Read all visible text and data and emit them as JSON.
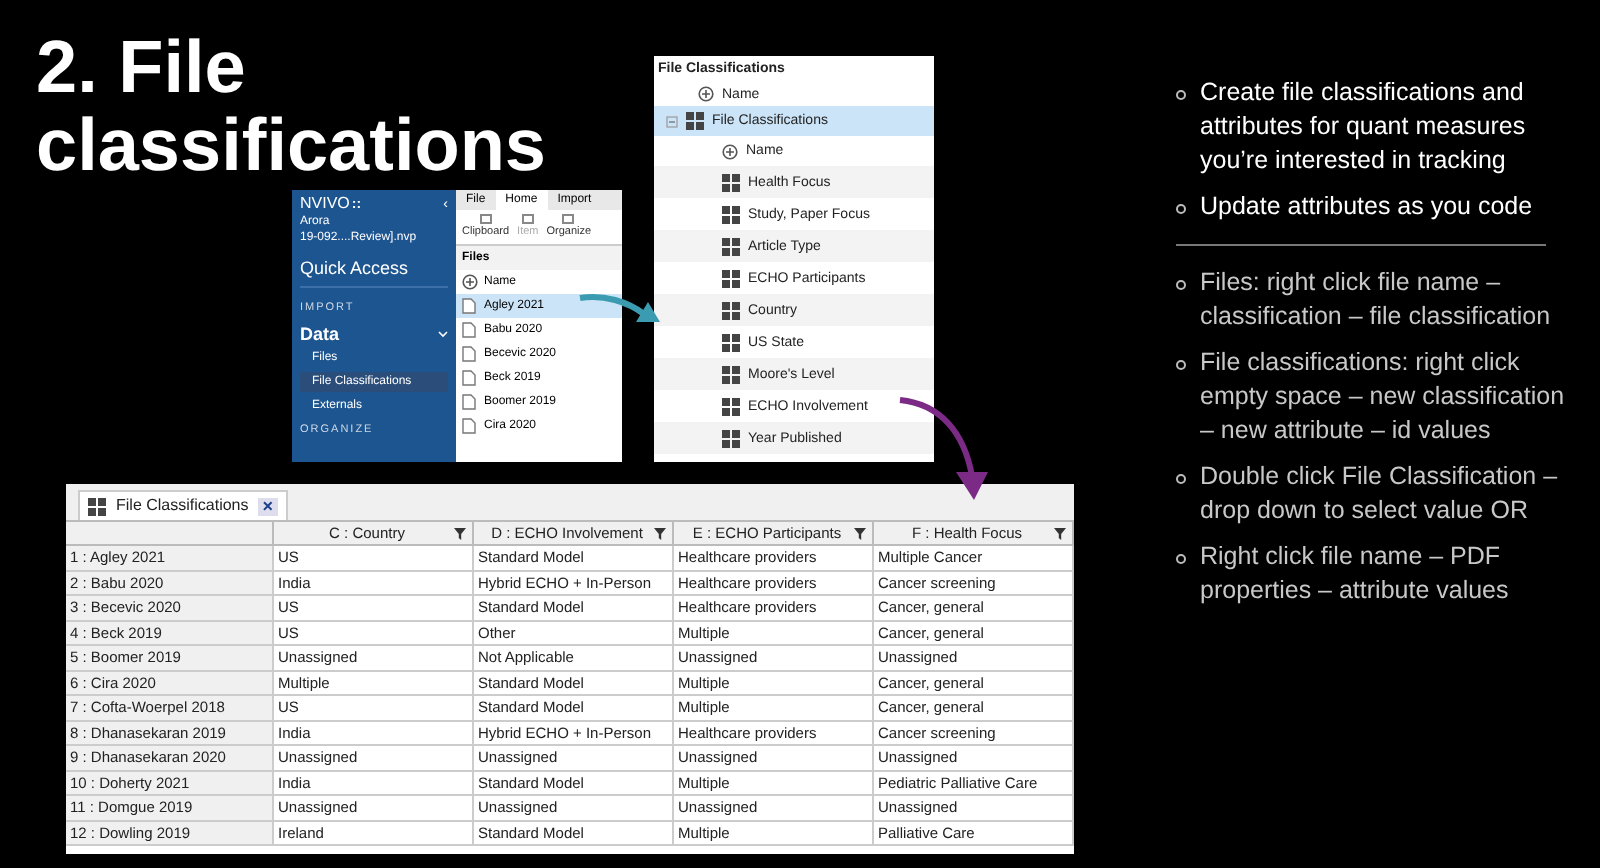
{
  "title": "2. File classifications",
  "nvivo": {
    "logo": "NVIVO",
    "logo_mark": "::",
    "collapse": "‹",
    "project": "Arora",
    "file": "19-092....Review].nvp",
    "nav": [
      {
        "kind": "link",
        "label": "Quick Access"
      },
      {
        "kind": "section",
        "label": "IMPORT"
      },
      {
        "kind": "group",
        "label": "Data",
        "expanded": true,
        "children": [
          {
            "label": "Files",
            "selected": false
          },
          {
            "label": "File Classifications",
            "selected": true
          },
          {
            "label": "Externals",
            "selected": false
          }
        ]
      },
      {
        "kind": "section",
        "label": "ORGANIZE"
      }
    ],
    "ribbon_tabs": [
      {
        "label": "File",
        "selected": false
      },
      {
        "label": "Home",
        "selected": true
      },
      {
        "label": "Import",
        "selected": false
      }
    ],
    "ribbon_buttons": [
      {
        "label": "Clipboard",
        "disabled": false
      },
      {
        "label": "Item",
        "disabled": true
      },
      {
        "label": "Organize",
        "disabled": false
      }
    ],
    "list_title": "Files",
    "list_header": "Name",
    "files": [
      {
        "name": "Agley 2021",
        "selected": true
      },
      {
        "name": "Babu 2020",
        "selected": false
      },
      {
        "name": "Becevic 2020",
        "selected": false
      },
      {
        "name": "Beck 2019",
        "selected": false
      },
      {
        "name": "Boomer 2019",
        "selected": false
      },
      {
        "name": "Cira 2020",
        "selected": false
      }
    ]
  },
  "classifications_panel": {
    "title": "File Classifications",
    "header": "Name",
    "tree": [
      {
        "label": "File Classifications",
        "selected": true,
        "expanded": true,
        "children": [
          {
            "kind": "header",
            "label": "Name"
          },
          {
            "kind": "attribute",
            "label": "Health Focus"
          },
          {
            "kind": "attribute",
            "label": "Study, Paper Focus"
          },
          {
            "kind": "attribute",
            "label": "Article Type"
          },
          {
            "kind": "attribute",
            "label": "ECHO Participants"
          },
          {
            "kind": "attribute",
            "label": "Country"
          },
          {
            "kind": "attribute",
            "label": "US State"
          },
          {
            "kind": "attribute",
            "label": "Moore's Level"
          },
          {
            "kind": "attribute",
            "label": "ECHO Involvement"
          },
          {
            "kind": "attribute",
            "label": "Year Published"
          }
        ]
      }
    ]
  },
  "table": {
    "tab": "File Classifications",
    "close": "×",
    "columns": [
      "",
      "C : Country",
      "D : ECHO Involvement",
      "E : ECHO Participants",
      "F : Health Focus"
    ],
    "rows": [
      [
        "1 : Agley 2021",
        "US",
        "Standard Model",
        "Healthcare providers",
        "Multiple Cancer"
      ],
      [
        "2 : Babu 2020",
        "India",
        "Hybrid ECHO + In-Person",
        "Healthcare providers",
        "Cancer screening"
      ],
      [
        "3 : Becevic 2020",
        "US",
        "Standard Model",
        "Healthcare providers",
        "Cancer, general"
      ],
      [
        "4 : Beck 2019",
        "US",
        "Other",
        "Multiple",
        "Cancer, general"
      ],
      [
        "5 : Boomer 2019",
        "Unassigned",
        "Not Applicable",
        "Unassigned",
        "Unassigned"
      ],
      [
        "6 : Cira 2020",
        "Multiple",
        "Standard Model",
        "Multiple",
        "Cancer, general"
      ],
      [
        "7 : Cofta-Woerpel 2018",
        "US",
        "Standard Model",
        "Multiple",
        "Cancer, general"
      ],
      [
        "8 : Dhanasekaran 2019",
        "India",
        "Hybrid ECHO + In-Person",
        "Healthcare providers",
        "Cancer screening"
      ],
      [
        "9 : Dhanasekaran 2020",
        "Unassigned",
        "Unassigned",
        "Unassigned",
        "Unassigned"
      ],
      [
        "10 : Doherty 2021",
        "India",
        "Standard Model",
        "Multiple",
        "Pediatric Palliative Care"
      ],
      [
        "11 : Domgue 2019",
        "Unassigned",
        "Unassigned",
        "Unassigned",
        "Unassigned"
      ],
      [
        "12 : Dowling 2019",
        "Ireland",
        "Standard Model",
        "Multiple",
        "Palliative Care"
      ]
    ]
  },
  "bullets_main": [
    "Create file classifications and attributes for quant measures you’re interested in tracking",
    "Update attributes as you code"
  ],
  "bullets_steps": [
    "Files: right click file name – classification – file classification",
    "File classifications: right click empty space – new classification – new attribute – id values",
    "Double click File Classification – drop down to select value OR",
    "Right click file name – PDF properties – attribute values"
  ]
}
